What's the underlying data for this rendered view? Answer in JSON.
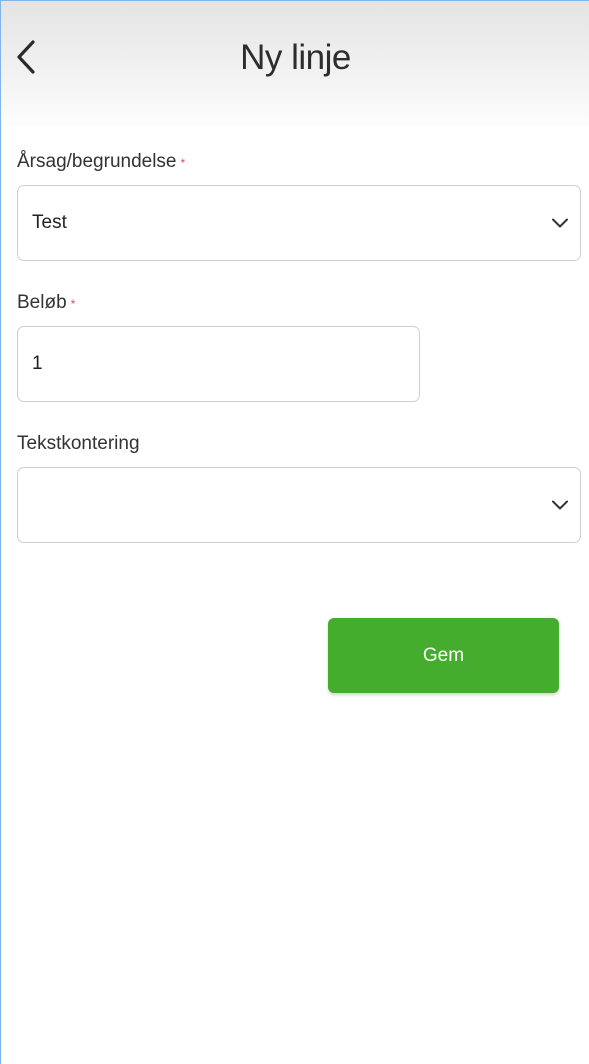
{
  "header": {
    "title": "Ny linje",
    "back_icon": "chevron-left-icon"
  },
  "form": {
    "reason": {
      "label": "Årsag/begrundelse",
      "required_marker": "*",
      "value": "Test",
      "icon": "chevron-down-icon"
    },
    "amount": {
      "label": "Beløb",
      "required_marker": "*",
      "value": "1"
    },
    "text_posting": {
      "label": "Tekstkontering",
      "value": "",
      "icon": "chevron-down-icon"
    }
  },
  "actions": {
    "save_label": "Gem"
  },
  "colors": {
    "primary_button": "#44ad2d",
    "required_marker": "#d9534f",
    "field_border": "#cfcfcf",
    "title_text": "#2d2d2d"
  }
}
